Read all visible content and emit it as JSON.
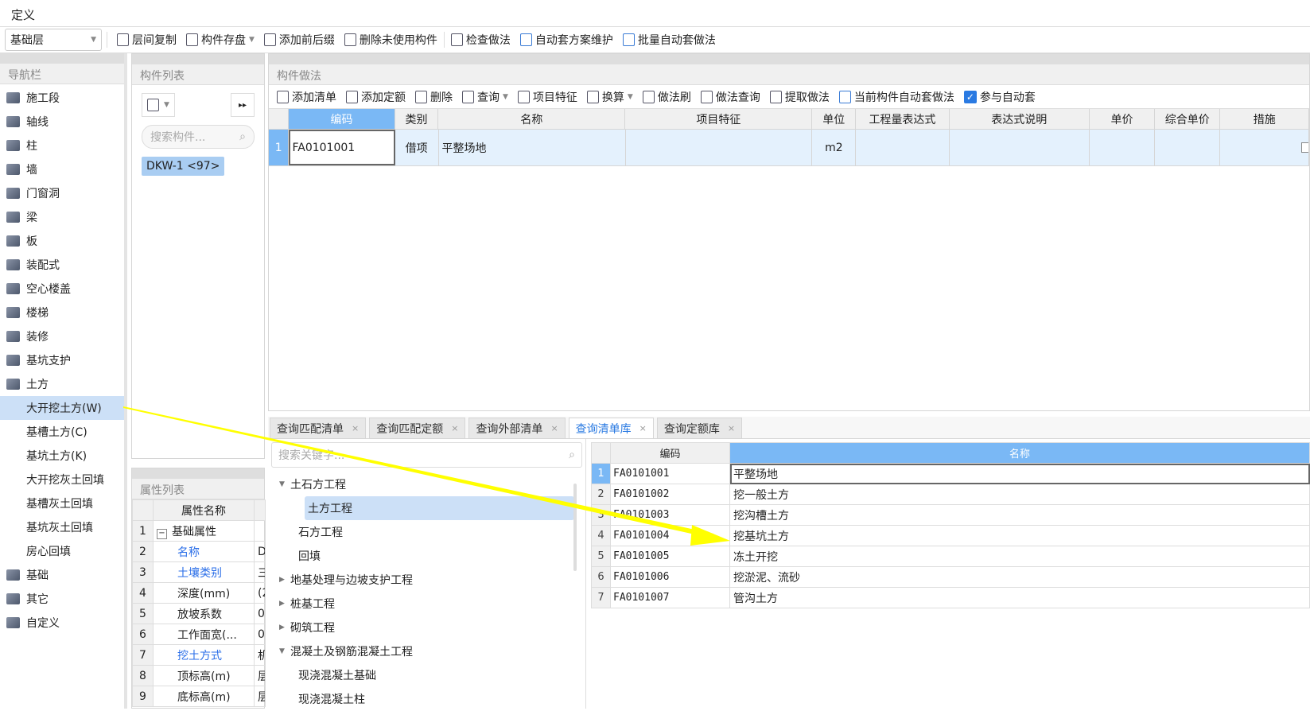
{
  "menu": {
    "title": "定义"
  },
  "toolbar": {
    "floor": "基础层",
    "items": [
      "层间复制",
      "构件存盘",
      "添加前后缀",
      "删除未使用构件",
      "检查做法",
      "自动套方案维护",
      "批量自动套做法"
    ]
  },
  "nav": {
    "title": "导航栏",
    "items": [
      {
        "label": "施工段",
        "sub": false
      },
      {
        "label": "轴线",
        "sub": false
      },
      {
        "label": "柱",
        "sub": false
      },
      {
        "label": "墙",
        "sub": false
      },
      {
        "label": "门窗洞",
        "sub": false
      },
      {
        "label": "梁",
        "sub": false
      },
      {
        "label": "板",
        "sub": false
      },
      {
        "label": "装配式",
        "sub": false
      },
      {
        "label": "空心楼盖",
        "sub": false
      },
      {
        "label": "楼梯",
        "sub": false
      },
      {
        "label": "装修",
        "sub": false
      },
      {
        "label": "基坑支护",
        "sub": false
      },
      {
        "label": "土方",
        "sub": false
      },
      {
        "label": "大开挖土方(W)",
        "sub": true,
        "selected": true
      },
      {
        "label": "基槽土方(C)",
        "sub": true
      },
      {
        "label": "基坑土方(K)",
        "sub": true
      },
      {
        "label": "大开挖灰土回填",
        "sub": true
      },
      {
        "label": "基槽灰土回填",
        "sub": true
      },
      {
        "label": "基坑灰土回填",
        "sub": true
      },
      {
        "label": "房心回填",
        "sub": true
      },
      {
        "label": "基础",
        "sub": false
      },
      {
        "label": "其它",
        "sub": false
      },
      {
        "label": "自定义",
        "sub": false
      }
    ]
  },
  "component_list": {
    "title": "构件列表",
    "search_placeholder": "搜索构件...",
    "items": [
      "DKW-1 <97>"
    ]
  },
  "properties": {
    "title": "属性列表",
    "header": "属性名称",
    "rows": [
      {
        "n": "1",
        "name": "基础属性",
        "value": "",
        "group": true
      },
      {
        "n": "2",
        "name": "名称",
        "value": "D",
        "blue": true
      },
      {
        "n": "3",
        "name": "土壤类别",
        "value": "三",
        "blue": true
      },
      {
        "n": "4",
        "name": "深度(mm)",
        "value": "(2"
      },
      {
        "n": "5",
        "name": "放坡系数",
        "value": "0"
      },
      {
        "n": "6",
        "name": "工作面宽(...",
        "value": "0"
      },
      {
        "n": "7",
        "name": "挖土方式",
        "value": "机",
        "blue": true
      },
      {
        "n": "8",
        "name": "顶标高(m)",
        "value": "层"
      },
      {
        "n": "9",
        "name": "底标高(m)",
        "value": "层"
      }
    ]
  },
  "main": {
    "title": "构件做法",
    "toolbar": [
      "添加清单",
      "添加定额",
      "删除",
      "查询",
      "项目特征",
      "换算",
      "做法刷",
      "做法查询",
      "提取做法",
      "当前构件自动套做法"
    ],
    "auto_checkbox": {
      "label": "参与自动套",
      "checked": true
    },
    "columns": [
      "编码",
      "类别",
      "名称",
      "项目特征",
      "单位",
      "工程量表达式",
      "表达式说明",
      "单价",
      "综合单价",
      "措施"
    ],
    "rows": [
      {
        "n": "1",
        "code": "FA0101001",
        "type": "借项",
        "name": "平整场地",
        "feature": "",
        "unit": "m2",
        "expr": "",
        "desc": "",
        "price": "",
        "total": ""
      }
    ]
  },
  "bottom": {
    "tabs": [
      "查询匹配清单",
      "查询匹配定额",
      "查询外部清单",
      "查询清单库",
      "查询定额库"
    ],
    "active_tab": 3,
    "search_placeholder": "搜索关键字...",
    "tree": [
      {
        "label": "土石方工程",
        "level": 0,
        "expanded": true
      },
      {
        "label": "土方工程",
        "level": 1,
        "selected": true
      },
      {
        "label": "石方工程",
        "level": 1
      },
      {
        "label": "回填",
        "level": 1
      },
      {
        "label": "地基处理与边坡支护工程",
        "level": 0,
        "expanded": false
      },
      {
        "label": "桩基工程",
        "level": 0,
        "expanded": false
      },
      {
        "label": "砌筑工程",
        "level": 0,
        "expanded": false
      },
      {
        "label": "混凝土及钢筋混凝土工程",
        "level": 0,
        "expanded": true
      },
      {
        "label": "现浇混凝土基础",
        "level": 1
      },
      {
        "label": "现浇混凝土柱",
        "level": 1
      }
    ],
    "lib_columns": [
      "编码",
      "名称"
    ],
    "lib_rows": [
      {
        "n": "1",
        "code": "FA0101001",
        "name": "平整场地"
      },
      {
        "n": "2",
        "code": "FA0101002",
        "name": "挖一般土方"
      },
      {
        "n": "3",
        "code": "FA0101003",
        "name": "挖沟槽土方"
      },
      {
        "n": "4",
        "code": "FA0101004",
        "name": "挖基坑土方"
      },
      {
        "n": "5",
        "code": "FA0101005",
        "name": "冻土开挖"
      },
      {
        "n": "6",
        "code": "FA0101006",
        "name": "挖淤泥、流砂"
      },
      {
        "n": "7",
        "code": "FA0101007",
        "name": "管沟土方"
      }
    ]
  },
  "colors": {
    "accent": "#2a7ae2",
    "selection": "#cce0f7",
    "header_blue": "#7ab8f5",
    "annotation": "#ffff00"
  }
}
